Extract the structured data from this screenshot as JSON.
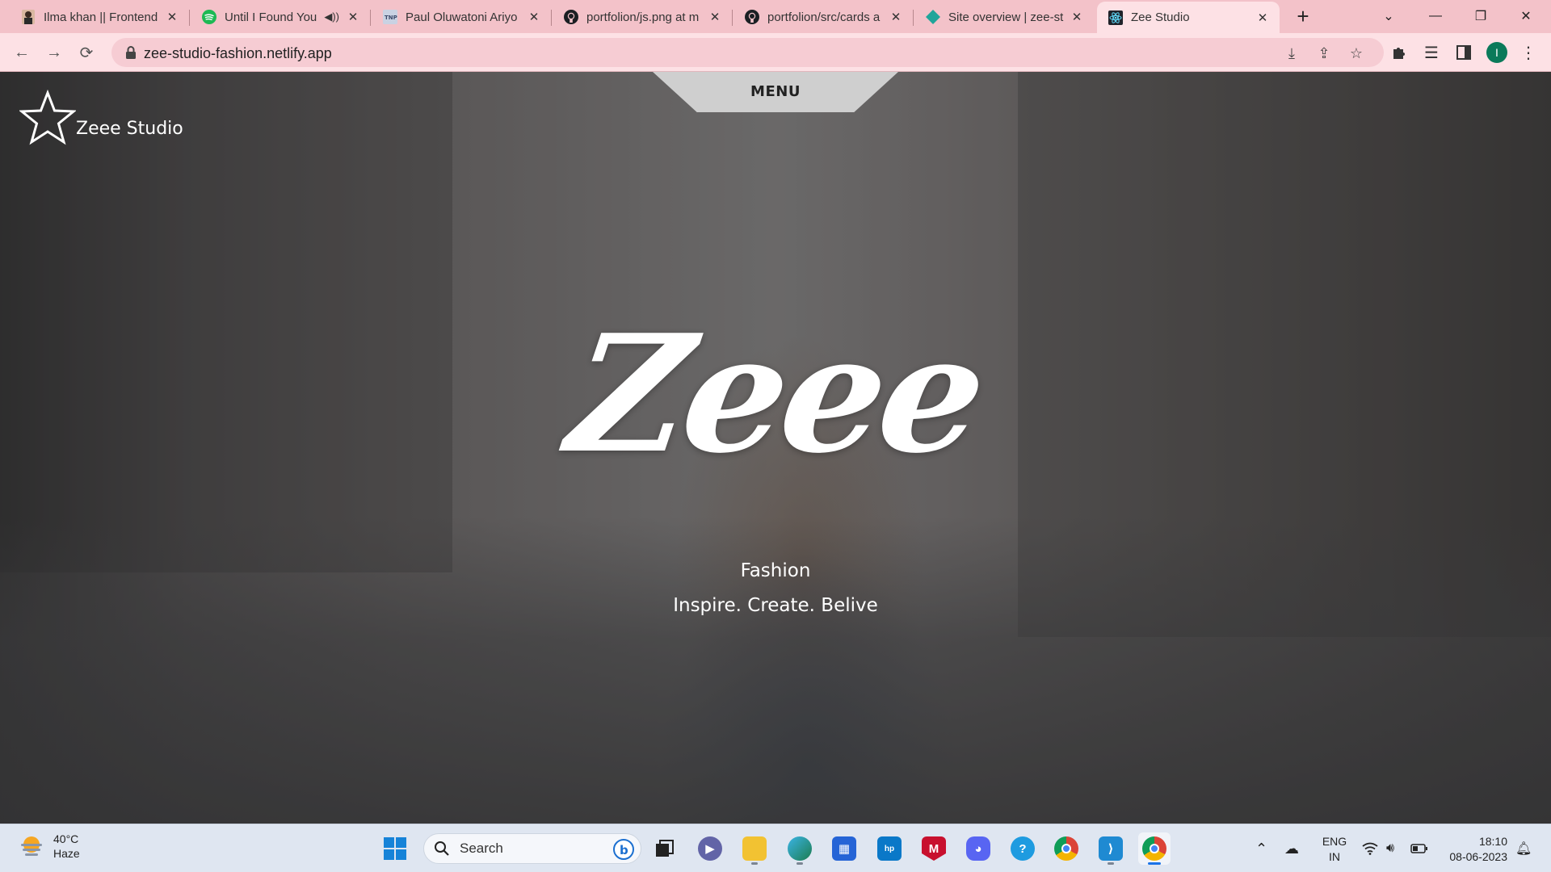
{
  "browser": {
    "tabs": [
      {
        "title": "Ilma khan || Frontend",
        "icon": "person-photo-icon",
        "active": false
      },
      {
        "title": "Until I Found You",
        "icon": "spotify-icon",
        "active": false,
        "muted": true
      },
      {
        "title": "Paul Oluwatoni Ariyo",
        "icon": "tnp-logo-icon",
        "active": false
      },
      {
        "title": "portfolion/js.png at m",
        "icon": "github-icon",
        "active": false
      },
      {
        "title": "portfolion/src/cards a",
        "icon": "github-icon",
        "active": false
      },
      {
        "title": "Site overview | zee-st",
        "icon": "netlify-icon",
        "active": false
      },
      {
        "title": "Zee Studio",
        "icon": "react-icon",
        "active": true
      }
    ],
    "url": "zee-studio-fashion.netlify.app",
    "profile_initial": "I",
    "accent": "#f3c2c9"
  },
  "page": {
    "menu_label": "MENU",
    "brand_name": "Zeee Studio",
    "hero_title": "Zeee",
    "hero_subtitle": "Fashion",
    "hero_tagline": "Inspire. Create. Belive"
  },
  "taskbar": {
    "weather_temp": "40°C",
    "weather_desc": "Haze",
    "search_placeholder": "Search",
    "lang_primary": "ENG",
    "lang_region": "IN",
    "time": "18:10",
    "date": "08-06-2023"
  }
}
